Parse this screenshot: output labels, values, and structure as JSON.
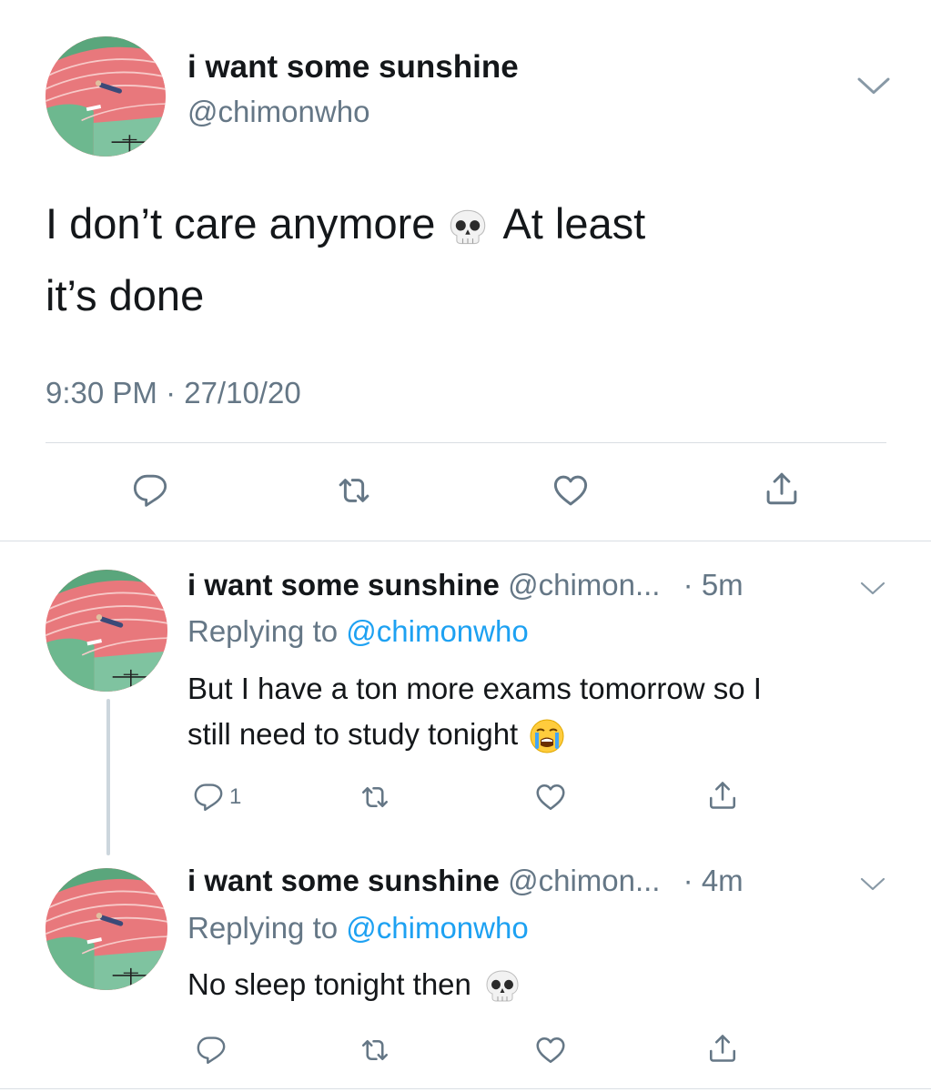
{
  "main_tweet": {
    "display_name": "i want some sunshine",
    "handle": "@chimonwho",
    "text_line1_a": "I don’t care anymore",
    "text_line1_b": "At least",
    "text_line2": "it’s done",
    "emoji": "skull",
    "timestamp": "9:30 PM · 27/10/20",
    "actions": [
      "reply-icon",
      "retweet-icon",
      "like-icon",
      "share-icon"
    ]
  },
  "replies": [
    {
      "display_name": "i want some sunshine",
      "handle": "@chimon...",
      "time": "· 5m",
      "replying_prefix": "Replying to",
      "replying_to": "@chimonwho",
      "text_line1": "But I have a ton more exams tomorrow so I",
      "text_line2": "still need to study tonight",
      "emoji": "loudly-crying-face",
      "reply_count": "1"
    },
    {
      "display_name": "i want some sunshine",
      "handle": "@chimon...",
      "time": "· 4m",
      "replying_prefix": "Replying to",
      "replying_to": "@chimonwho",
      "text_line1": "No sleep tonight then",
      "emoji": "skull"
    }
  ],
  "colors": {
    "primary_text": "#14171a",
    "secondary_text": "#657786",
    "link": "#1da1f2",
    "divider": "#d9dee3",
    "icon": "#657786"
  }
}
